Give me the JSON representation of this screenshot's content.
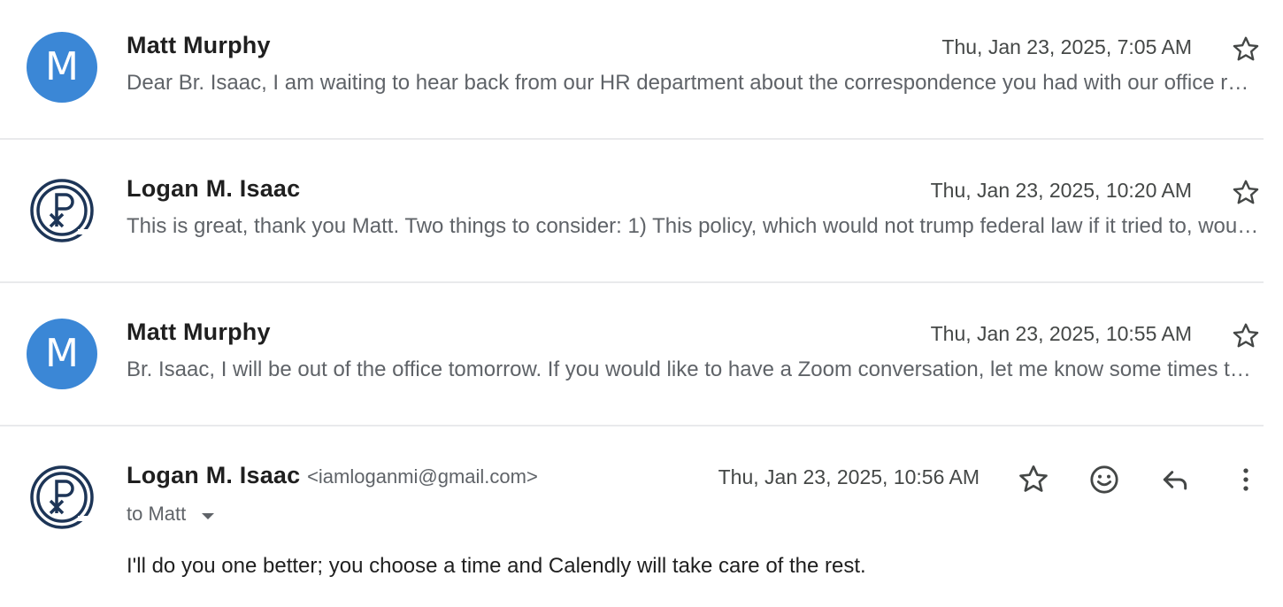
{
  "messages": [
    {
      "sender": "Matt Murphy",
      "avatar_letter": "M",
      "date": "Thu, Jan 23, 2025, 7:05 AM",
      "snippet": "Dear Br. Isaac, I am waiting to hear back from our HR department about the correspondence you had with our office regarding the policy."
    },
    {
      "sender": "Logan M. Isaac",
      "date": "Thu, Jan 23, 2025, 10:20 AM",
      "snippet": "This is great, thank you Matt. Two things to consider: 1) This policy, which would not trump federal law if it tried to, would need review."
    },
    {
      "sender": "Matt Murphy",
      "avatar_letter": "M",
      "date": "Thu, Jan 23, 2025, 10:55 AM",
      "snippet": "Br. Isaac, I will be out of the office tomorrow. If you would like to have a Zoom conversation, let me know some times that work for you."
    }
  ],
  "expanded": {
    "sender": "Logan M. Isaac",
    "email": "<iamloganmi@gmail.com>",
    "date": "Thu, Jan 23, 2025, 10:56 AM",
    "to": "to Matt",
    "body": "I'll do you one better; you choose a time and Calendly will take care of the rest."
  },
  "icons": {
    "star": "star-icon",
    "emoji": "emoji-reaction-icon",
    "reply": "reply-icon",
    "more": "more-vertical-icon",
    "logo": "chi-rho-logo-icon"
  },
  "colors": {
    "avatar_blue": "#3b87d6",
    "logo_navy": "#1d3557",
    "divider": "#e9eaec"
  }
}
